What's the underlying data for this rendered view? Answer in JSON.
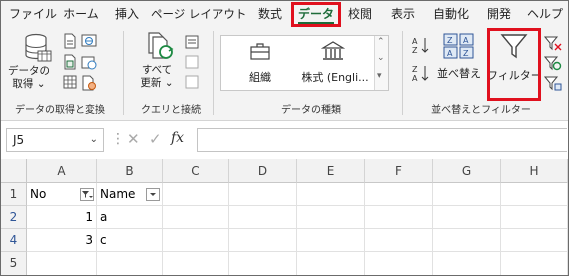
{
  "menu": {
    "tabs": [
      "ファイル",
      "ホーム",
      "挿入",
      "ページ レイアウト",
      "数式",
      "データ",
      "校閲",
      "表示",
      "自動化",
      "開発",
      "ヘルプ"
    ],
    "active_tab": "データ"
  },
  "ribbon": {
    "get_data_label_1": "データの",
    "get_data_label_2": "取得",
    "group_get_transform": "データの取得と変換",
    "refresh_label_1": "すべて",
    "refresh_label_2": "更新",
    "group_queries": "クエリと接続",
    "datatype_org": "組織",
    "datatype_stocks": "株式 (Engli...",
    "group_data_types": "データの種類",
    "sort_label": "並べ替え",
    "filter_label": "フィルター",
    "group_sort_filter": "並べ替えとフィルター"
  },
  "formula_bar": {
    "name_box": "J5",
    "fx": "fx",
    "formula": ""
  },
  "sheet": {
    "columns": [
      "A",
      "B",
      "C",
      "D",
      "E",
      "F",
      "G",
      "H"
    ],
    "rows": [
      {
        "num": "1",
        "a": "No",
        "b": "Name"
      },
      {
        "num": "2",
        "a": "1",
        "b": "a"
      },
      {
        "num": "4",
        "a": "3",
        "b": "c"
      },
      {
        "num": "5",
        "a": "",
        "b": ""
      }
    ]
  },
  "colors": {
    "highlight": "#e0101e",
    "accent_green": "#1e6b3a",
    "filtered_row_header": "#2f5597"
  }
}
